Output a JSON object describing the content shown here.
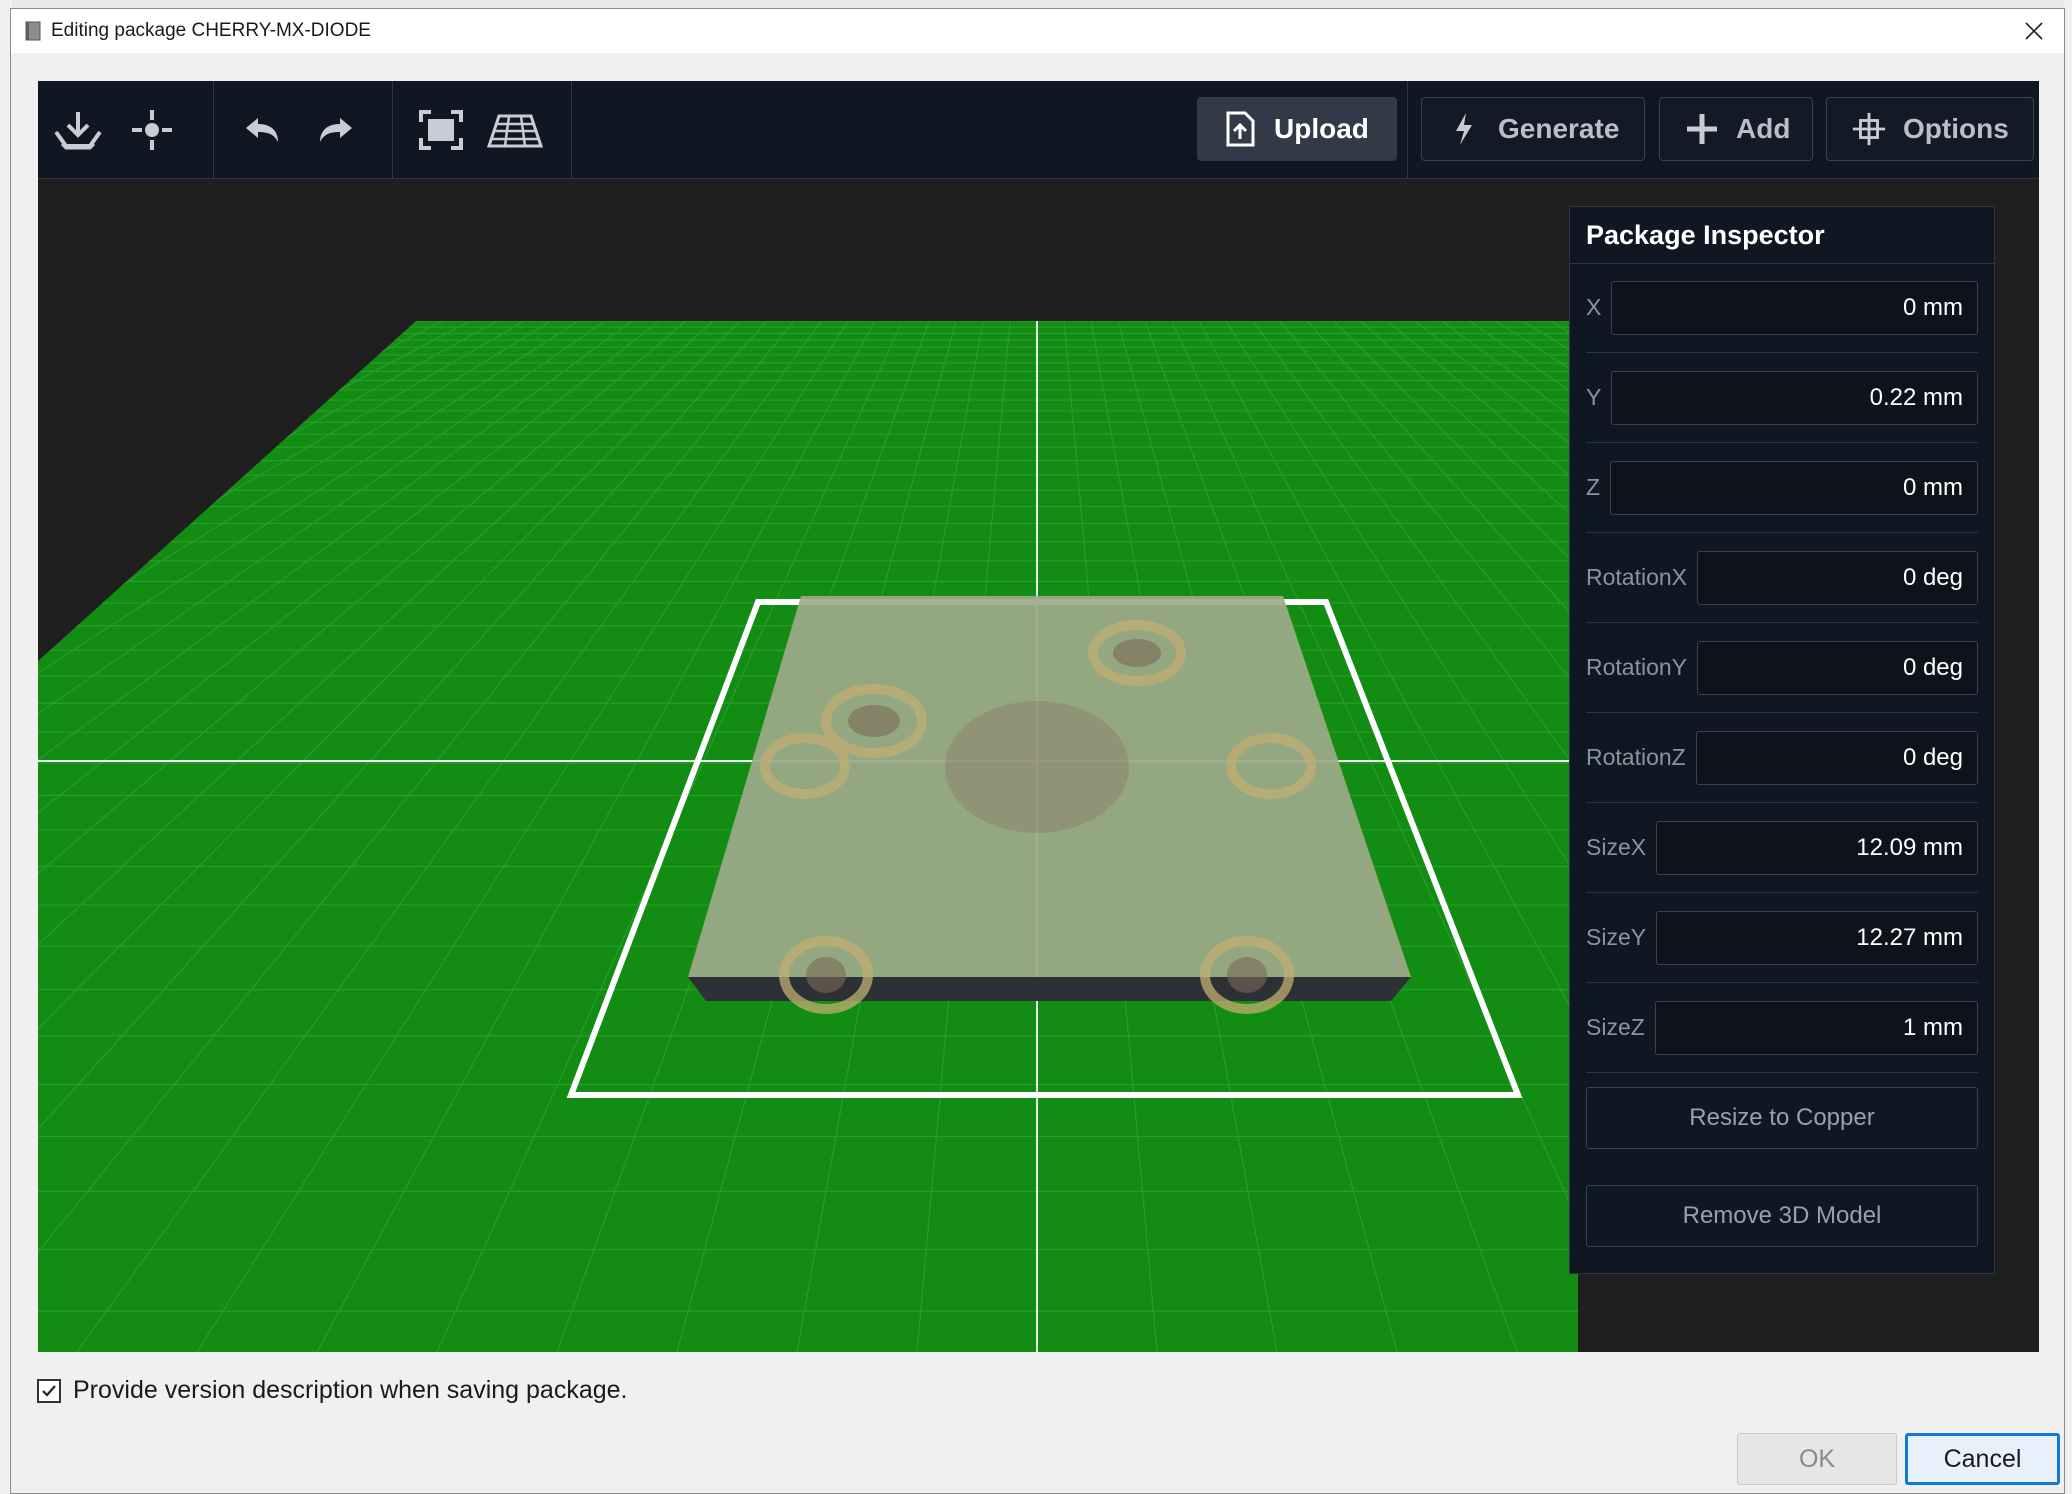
{
  "window": {
    "title": "Editing package CHERRY-MX-DIODE"
  },
  "toolbar": {
    "icons": [
      "import-icon",
      "origin-icon",
      "undo-icon",
      "redo-icon",
      "fit-view-icon",
      "grid-view-icon"
    ],
    "upload_label": "Upload",
    "generate_label": "Generate",
    "add_label": "Add",
    "options_label": "Options"
  },
  "inspector": {
    "title": "Package Inspector",
    "properties": [
      {
        "label": "X",
        "value": "0 mm"
      },
      {
        "label": "Y",
        "value": "0.22 mm"
      },
      {
        "label": "Z",
        "value": "0 mm"
      },
      {
        "label": "RotationX",
        "value": "0 deg"
      },
      {
        "label": "RotationY",
        "value": "0 deg"
      },
      {
        "label": "RotationZ",
        "value": "0 deg"
      },
      {
        "label": "SizeX",
        "value": "12.09 mm"
      },
      {
        "label": "SizeY",
        "value": "12.27 mm"
      },
      {
        "label": "SizeZ",
        "value": "1 mm"
      }
    ],
    "resize_label": "Resize to Copper",
    "remove_label": "Remove 3D Model"
  },
  "footer": {
    "checkbox_label": "Provide version description when saving package.",
    "checkbox_checked": true,
    "ok_label": "OK",
    "cancel_label": "Cancel"
  },
  "colors": {
    "ground": "#138c13",
    "toolbar_bg": "#111722",
    "board": "#8c9e78",
    "pad": "#b8a36a",
    "accent": "#0f7bd6"
  }
}
